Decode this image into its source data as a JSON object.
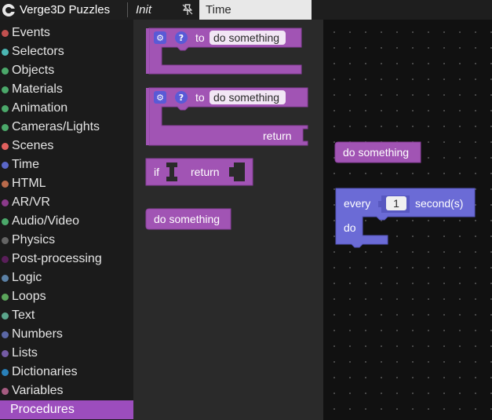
{
  "app": {
    "title": "Verge3D Puzzles",
    "tabs": [
      {
        "label": "Init",
        "italic": true
      },
      {
        "label": "Time",
        "active": true
      }
    ]
  },
  "sidebar": {
    "categories": [
      {
        "label": "Events",
        "color": "#c0504f"
      },
      {
        "label": "Selectors",
        "color": "#4bb6b3"
      },
      {
        "label": "Objects",
        "color": "#4ba86a"
      },
      {
        "label": "Materials",
        "color": "#4ba86a"
      },
      {
        "label": "Animation",
        "color": "#4ba86a"
      },
      {
        "label": "Cameras/Lights",
        "color": "#4ba86a"
      },
      {
        "label": "Scenes",
        "color": "#e0605e"
      },
      {
        "label": "Time",
        "color": "#5b67c8"
      },
      {
        "label": "HTML",
        "color": "#b96a4b"
      },
      {
        "label": "AR/VR",
        "color": "#8a3a8a"
      },
      {
        "label": "Audio/Video",
        "color": "#4ba86a"
      },
      {
        "label": "Physics",
        "color": "#646464"
      },
      {
        "label": "Post-processing",
        "color": "#5a1f5a"
      },
      {
        "label": "Logic",
        "color": "#5b80a5"
      },
      {
        "label": "Loops",
        "color": "#5ba55b"
      },
      {
        "label": "Text",
        "color": "#5ba58c"
      },
      {
        "label": "Numbers",
        "color": "#5b67a5"
      },
      {
        "label": "Lists",
        "color": "#745ba5"
      },
      {
        "label": "Dictionaries",
        "color": "#2980b9"
      },
      {
        "label": "Variables",
        "color": "#a55b80"
      },
      {
        "label": "Procedures",
        "color": "#9c4dbd",
        "selected": true
      }
    ]
  },
  "flyout": {
    "proc_noreturn": {
      "to": "to",
      "name": "do something"
    },
    "proc_return": {
      "to": "to",
      "name": "do something",
      "return": "return"
    },
    "if_return": {
      "if": "if",
      "return": "return"
    },
    "call": {
      "label": "do something"
    }
  },
  "workspace": {
    "call": {
      "label": "do something"
    },
    "every": {
      "every": "every",
      "value": "1",
      "unit": "second(s)",
      "do": "do"
    }
  },
  "colors": {
    "procedure": "#a154b4",
    "time": "#6b6bd6",
    "selected_category": "#9c4dbd"
  }
}
